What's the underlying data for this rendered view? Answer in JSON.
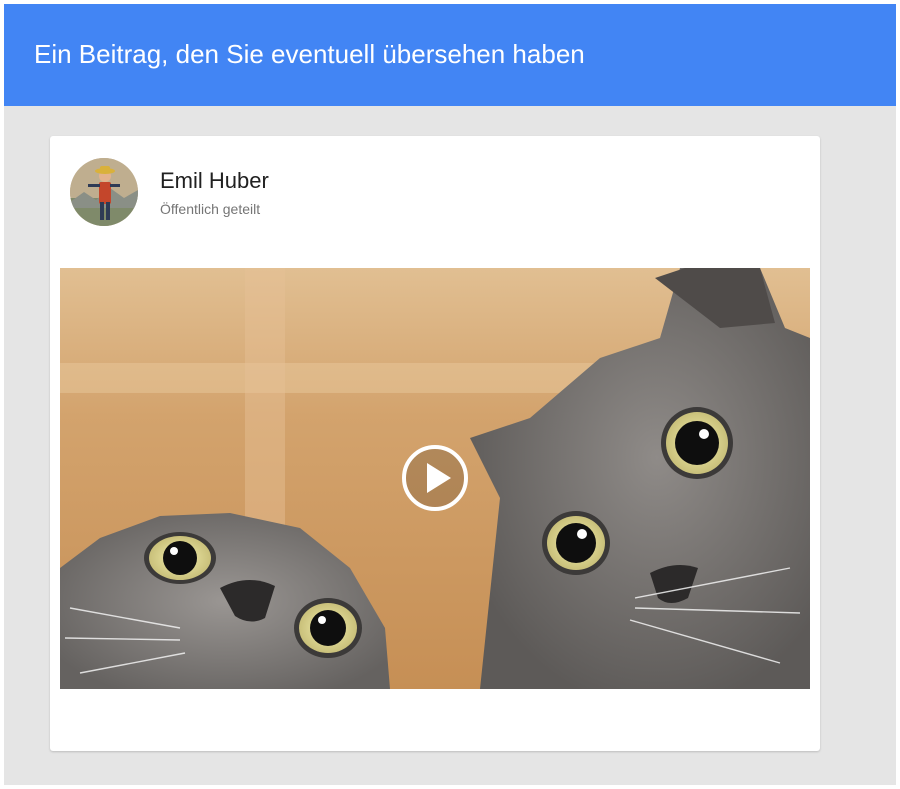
{
  "header": {
    "title": "Ein Beitrag, den Sie eventuell übersehen haben",
    "background_color": "#4285f4"
  },
  "post": {
    "author_name": "Emil Huber",
    "share_status": "Öffentlich geteilt",
    "media": {
      "kind": "video",
      "description_icon": "play-icon"
    }
  }
}
